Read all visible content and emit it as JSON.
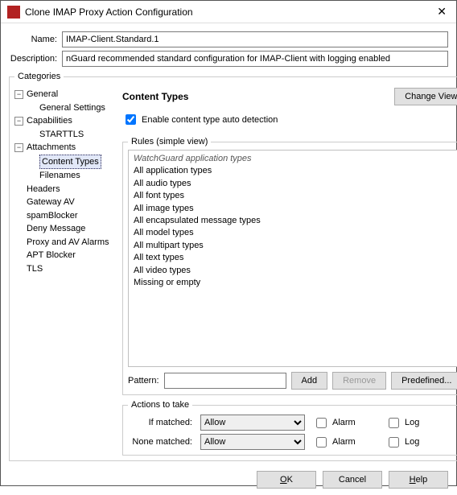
{
  "window": {
    "title": "Clone IMAP Proxy Action Configuration"
  },
  "form": {
    "name_label": "Name:",
    "name_value": "IMAP-Client.Standard.1",
    "desc_label": "Description:",
    "desc_value": "nGuard recommended standard configuration for IMAP-Client with logging enabled"
  },
  "fieldsets": {
    "categories": "Categories",
    "rules": "Rules (simple view)",
    "actions": "Actions to take"
  },
  "tree": [
    {
      "level": 1,
      "label": "General",
      "expanded": true
    },
    {
      "level": 2,
      "label": "General Settings"
    },
    {
      "level": 1,
      "label": "Capabilities",
      "expanded": true
    },
    {
      "level": 2,
      "label": "STARTTLS"
    },
    {
      "level": 1,
      "label": "Attachments",
      "expanded": true
    },
    {
      "level": 2,
      "label": "Content Types",
      "selected": true
    },
    {
      "level": 2,
      "label": "Filenames"
    },
    {
      "level": 1,
      "label": "Headers"
    },
    {
      "level": 1,
      "label": "Gateway AV"
    },
    {
      "level": 1,
      "label": "spamBlocker"
    },
    {
      "level": 1,
      "label": "Deny Message"
    },
    {
      "level": 1,
      "label": "Proxy and AV Alarms"
    },
    {
      "level": 1,
      "label": "APT Blocker"
    },
    {
      "level": 1,
      "label": "TLS"
    }
  ],
  "panel": {
    "title": "Content Types",
    "change_view": "Change View",
    "enable_auto": "Enable content type auto detection",
    "pattern_label": "Pattern:",
    "add": "Add",
    "remove": "Remove",
    "predefined": "Predefined..."
  },
  "rules": [
    {
      "text": "WatchGuard application types",
      "italic": true
    },
    {
      "text": "All application types"
    },
    {
      "text": "All audio types"
    },
    {
      "text": "All font types"
    },
    {
      "text": "All image types"
    },
    {
      "text": "All encapsulated message types"
    },
    {
      "text": "All model types"
    },
    {
      "text": "All multipart types"
    },
    {
      "text": "All text types"
    },
    {
      "text": "All video types"
    },
    {
      "text": "Missing or empty"
    }
  ],
  "actions": {
    "if_matched": "If matched:",
    "none_matched": "None matched:",
    "options": [
      "Allow"
    ],
    "alarm": "Alarm",
    "log": "Log"
  },
  "buttons": {
    "ok": "OK",
    "cancel": "Cancel",
    "help": "Help"
  }
}
